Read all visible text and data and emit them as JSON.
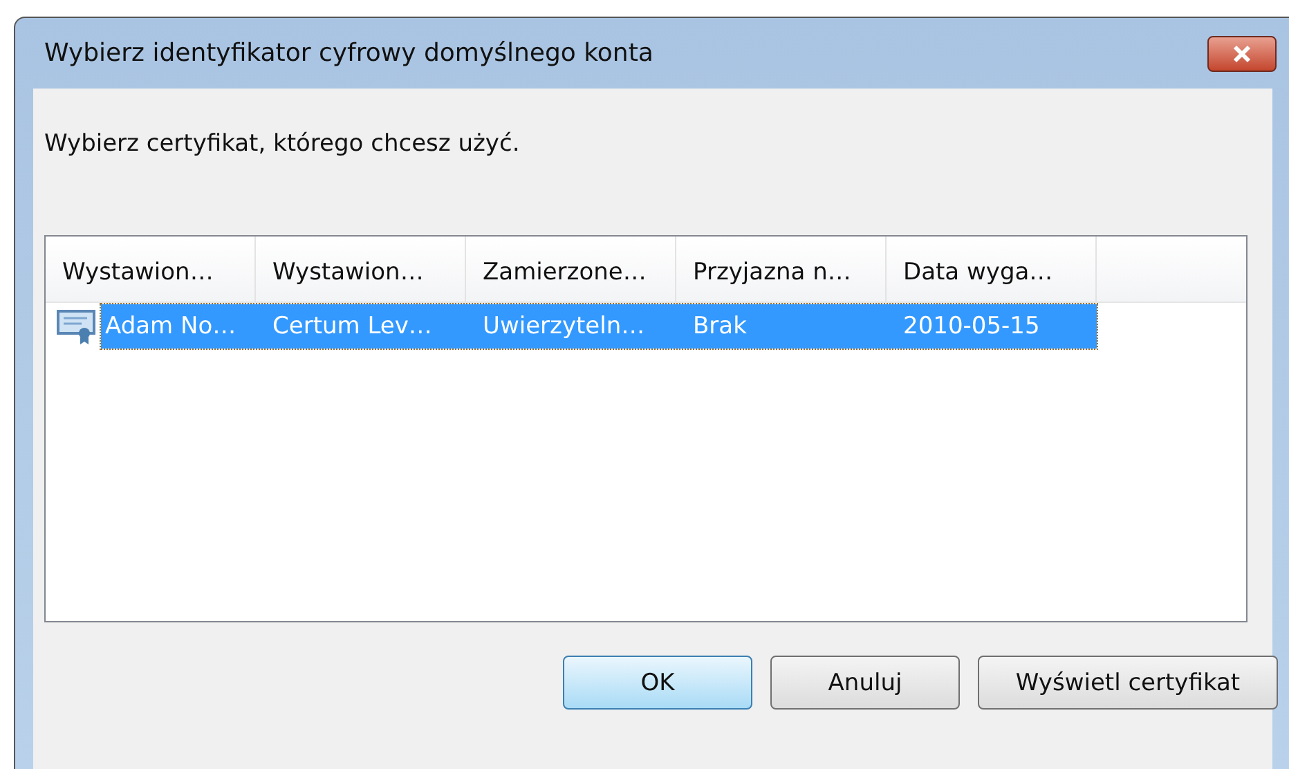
{
  "window": {
    "title": "Wybierz identyfikator cyfrowy domyślnego konta"
  },
  "instruction": "Wybierz certyfikat, którego chcesz użyć.",
  "table": {
    "columns": [
      "Wystawion…",
      "Wystawion…",
      "Zamierzone…",
      "Przyjazna n…",
      "Data wyga…"
    ],
    "rows": [
      {
        "cells": [
          "Adam No…",
          "Certum Lev…",
          "Uwierzyteln…",
          "Brak",
          "2010-05-15"
        ],
        "selected": true
      }
    ]
  },
  "buttons": [
    {
      "label": "OK",
      "default": true
    },
    {
      "label": "Anuluj",
      "default": false
    },
    {
      "label": "Wyświetl certyfikat",
      "default": false
    }
  ]
}
